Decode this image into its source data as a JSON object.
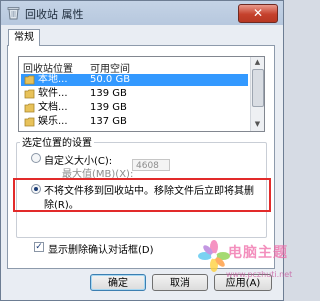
{
  "window": {
    "title": "回收站 属性",
    "close_glyph": "✕"
  },
  "tabs": [
    {
      "label": "常规",
      "active": true
    }
  ],
  "location_list": {
    "headers": {
      "location": "回收站位置",
      "space": "可用空间"
    },
    "rows": [
      {
        "name": "本地...",
        "space": "50.0 GB",
        "selected": true
      },
      {
        "name": "软件...",
        "space": "139 GB",
        "selected": false
      },
      {
        "name": "文档...",
        "space": "139 GB",
        "selected": false
      },
      {
        "name": "娱乐...",
        "space": "137 GB",
        "selected": false
      }
    ]
  },
  "settings": {
    "legend": "选定位置的设置",
    "custom_size_label": "自定义大小(C):",
    "max_size_label": "最大值(MB)(X):",
    "max_size_value": "4608",
    "delete_immediately_label_line1": "不将文件移到回收站中。移除文件后立即将其删",
    "delete_immediately_label_line2": "除(R)。",
    "custom_size_selected": false,
    "delete_immediately_selected": true
  },
  "confirm_dialog": {
    "label": "显示删除确认对话框(D)",
    "checked": true,
    "check_glyph": "✓"
  },
  "buttons": {
    "ok": "确定",
    "cancel": "取消",
    "apply": "应用(A)"
  },
  "watermark": {
    "text": "电脑主题",
    "url": "www.pczhuti.net"
  },
  "colors": {
    "selection": "#3399ff",
    "highlight_border": "#e22a2a",
    "close_button": "#c5412c"
  },
  "icons": {
    "title": "recycle-bin-icon",
    "drive": "drive-icon"
  }
}
